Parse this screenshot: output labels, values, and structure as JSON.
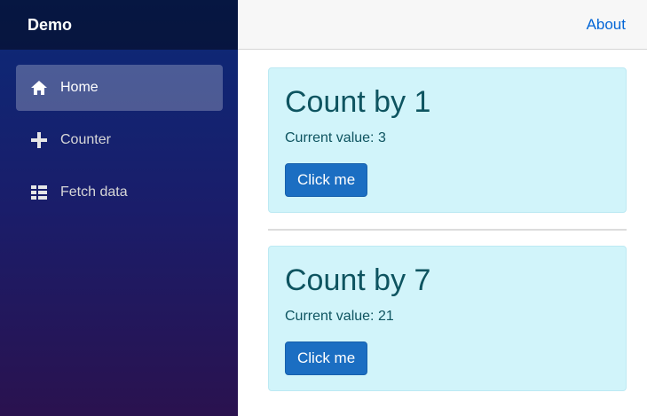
{
  "brand": "Demo",
  "nav": [
    {
      "label": "Home",
      "icon": "home-icon",
      "active": true
    },
    {
      "label": "Counter",
      "icon": "plus-icon",
      "active": false
    },
    {
      "label": "Fetch data",
      "icon": "list-icon",
      "active": false
    }
  ],
  "topbar": {
    "about": "About"
  },
  "counters": [
    {
      "title": "Count by 1",
      "current": "Current value: 3",
      "button": "Click me"
    },
    {
      "title": "Count by 7",
      "current": "Current value: 21",
      "button": "Click me"
    }
  ],
  "colors": {
    "sidebar_top": "#0b2a78",
    "sidebar_bottom": "#2a124f",
    "card_bg": "#d1f4fa",
    "card_text": "#0e5460",
    "button_bg": "#1b6ec2",
    "link": "#0366d6"
  }
}
